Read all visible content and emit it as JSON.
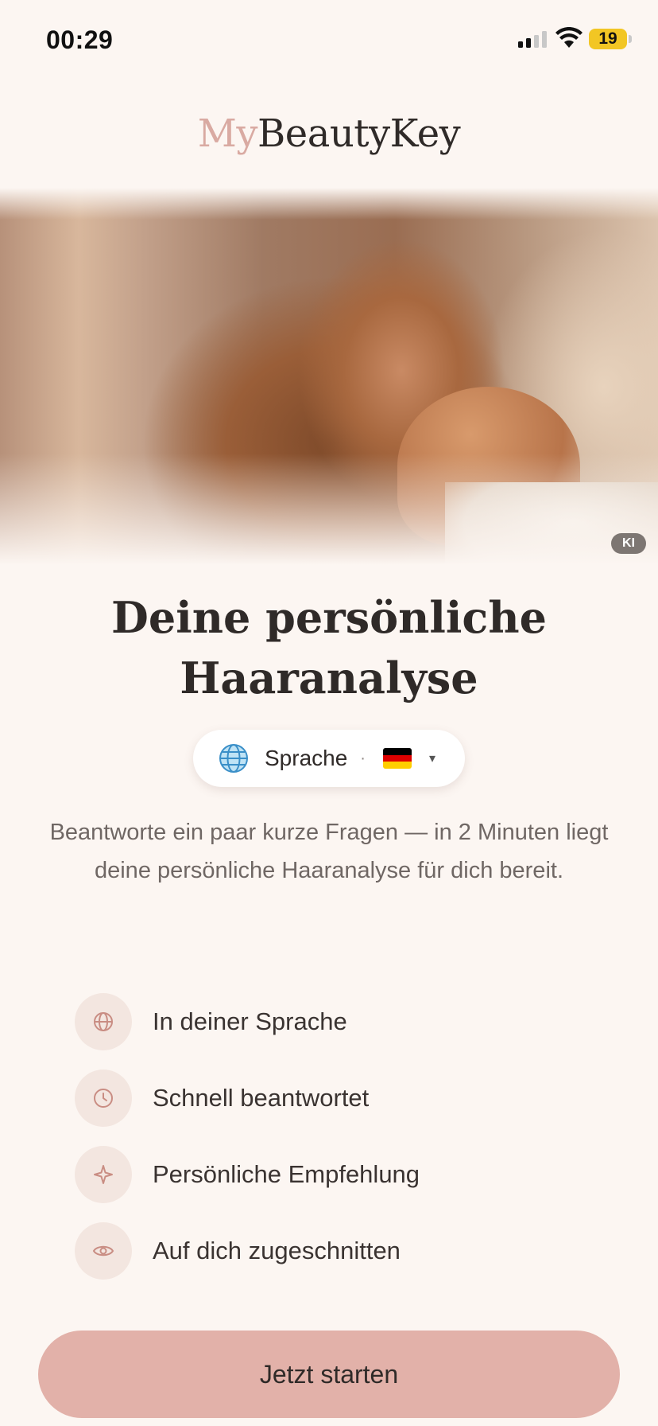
{
  "status_bar": {
    "time": "00:29",
    "battery": "19",
    "battery_color": "#f2c624",
    "icons": [
      "signal-icon",
      "wifi-icon",
      "battery-icon"
    ]
  },
  "logo": {
    "part1": "My",
    "part2": "BeautyKey"
  },
  "hero": {
    "badge": "KI"
  },
  "title": {
    "line1": "Deine persönliche",
    "line2": "Haaranalyse"
  },
  "language_selector": {
    "label": "Sprache",
    "separator": "·",
    "flag": "german-flag",
    "caret": "▾"
  },
  "description": "Beantworte ein paar kurze Fragen — in 2 Minuten liegt deine persönliche Haaranalyse für dich bereit.",
  "features": [
    {
      "icon": "globe-icon",
      "label": "In deiner Sprache"
    },
    {
      "icon": "clock-icon",
      "label": "Schnell beantwortet"
    },
    {
      "icon": "sparkle-icon",
      "label": "Persönliche Empfehlung"
    },
    {
      "icon": "eye-icon",
      "label": "Auf dich zugeschnitten"
    }
  ],
  "cta": {
    "label": "Jetzt starten"
  },
  "colors": {
    "background": "#fcf6f2",
    "accent": "#e2b1a9",
    "logo_accent": "#d9aaa2",
    "icon_bg": "#f3e6e0",
    "icon_stroke": "#c98d83"
  }
}
